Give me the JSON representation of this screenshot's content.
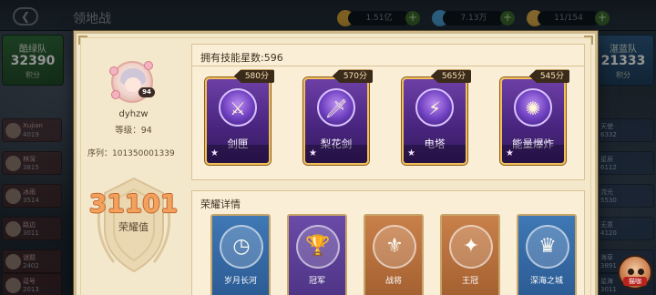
{
  "background": {
    "title": "领地战",
    "resources": [
      {
        "value": "1.51亿",
        "icon": "gold-coin-icon"
      },
      {
        "value": "7.13万",
        "icon": "gem-icon"
      },
      {
        "value": "11/154",
        "icon": "stamina-icon"
      }
    ],
    "left_team": {
      "name": "酷绿队",
      "score": "32390",
      "sub": "积分"
    },
    "right_team": {
      "name": "湛蓝队",
      "score": "21333",
      "sub": "积分"
    },
    "left_rows": [
      {
        "name": "Xujian",
        "value": "4019"
      },
      {
        "name": "林深",
        "value": "3815"
      },
      {
        "name": "冰雨",
        "value": "3514"
      },
      {
        "name": "路边",
        "value": "3011"
      },
      {
        "name": "谜题",
        "value": "2402"
      },
      {
        "name": "逗号",
        "value": "2013"
      }
    ],
    "right_rows": [
      {
        "name": "天使",
        "value": "6332"
      },
      {
        "name": "星辰",
        "value": "6112"
      },
      {
        "name": "流光",
        "value": "5530"
      },
      {
        "name": "无意",
        "value": "4120"
      },
      {
        "name": "海草",
        "value": "3891"
      },
      {
        "name": "星海",
        "value": "3011"
      }
    ],
    "mascot_label": "猫咖"
  },
  "profile": {
    "username": "dyhzw",
    "level_label": "等级：94",
    "level_badge": "94",
    "serial_label": "序列：101350001339",
    "honor_value": "31101",
    "honor_label": "荣耀值"
  },
  "skills": {
    "title": "拥有技能星数:596",
    "cards": [
      {
        "name": "剑匣",
        "score": "580分",
        "icon": "sword-case-icon",
        "glyph": "⚔"
      },
      {
        "name": "梨花剑",
        "score": "570分",
        "icon": "pear-sword-icon",
        "glyph": "🗡"
      },
      {
        "name": "电塔",
        "score": "565分",
        "icon": "electric-tower-icon",
        "glyph": "⚡"
      },
      {
        "name": "能量爆炸",
        "score": "545分",
        "icon": "energy-burst-icon",
        "glyph": "✺"
      }
    ]
  },
  "honor_details": {
    "title": "荣耀详情",
    "cards": [
      {
        "name": "岁月长河",
        "color": "blue",
        "icon": "clock-icon",
        "glyph": "◷"
      },
      {
        "name": "冠军",
        "color": "purple",
        "icon": "trophy-icon",
        "glyph": "🏆"
      },
      {
        "name": "战将",
        "color": "orange",
        "icon": "sword-emblem-icon",
        "glyph": "⚜"
      },
      {
        "name": "王冠",
        "color": "orange",
        "icon": "compass-emblem-icon",
        "glyph": "✦"
      },
      {
        "name": "深海之城",
        "color": "blue",
        "icon": "helmet-icon",
        "glyph": "♛"
      }
    ]
  },
  "colors": {
    "panel_bg": "#f4e8cc",
    "skill_card": "#4a2680",
    "honor_number": "#f3a25e",
    "gold_border": "#f0c15a"
  }
}
